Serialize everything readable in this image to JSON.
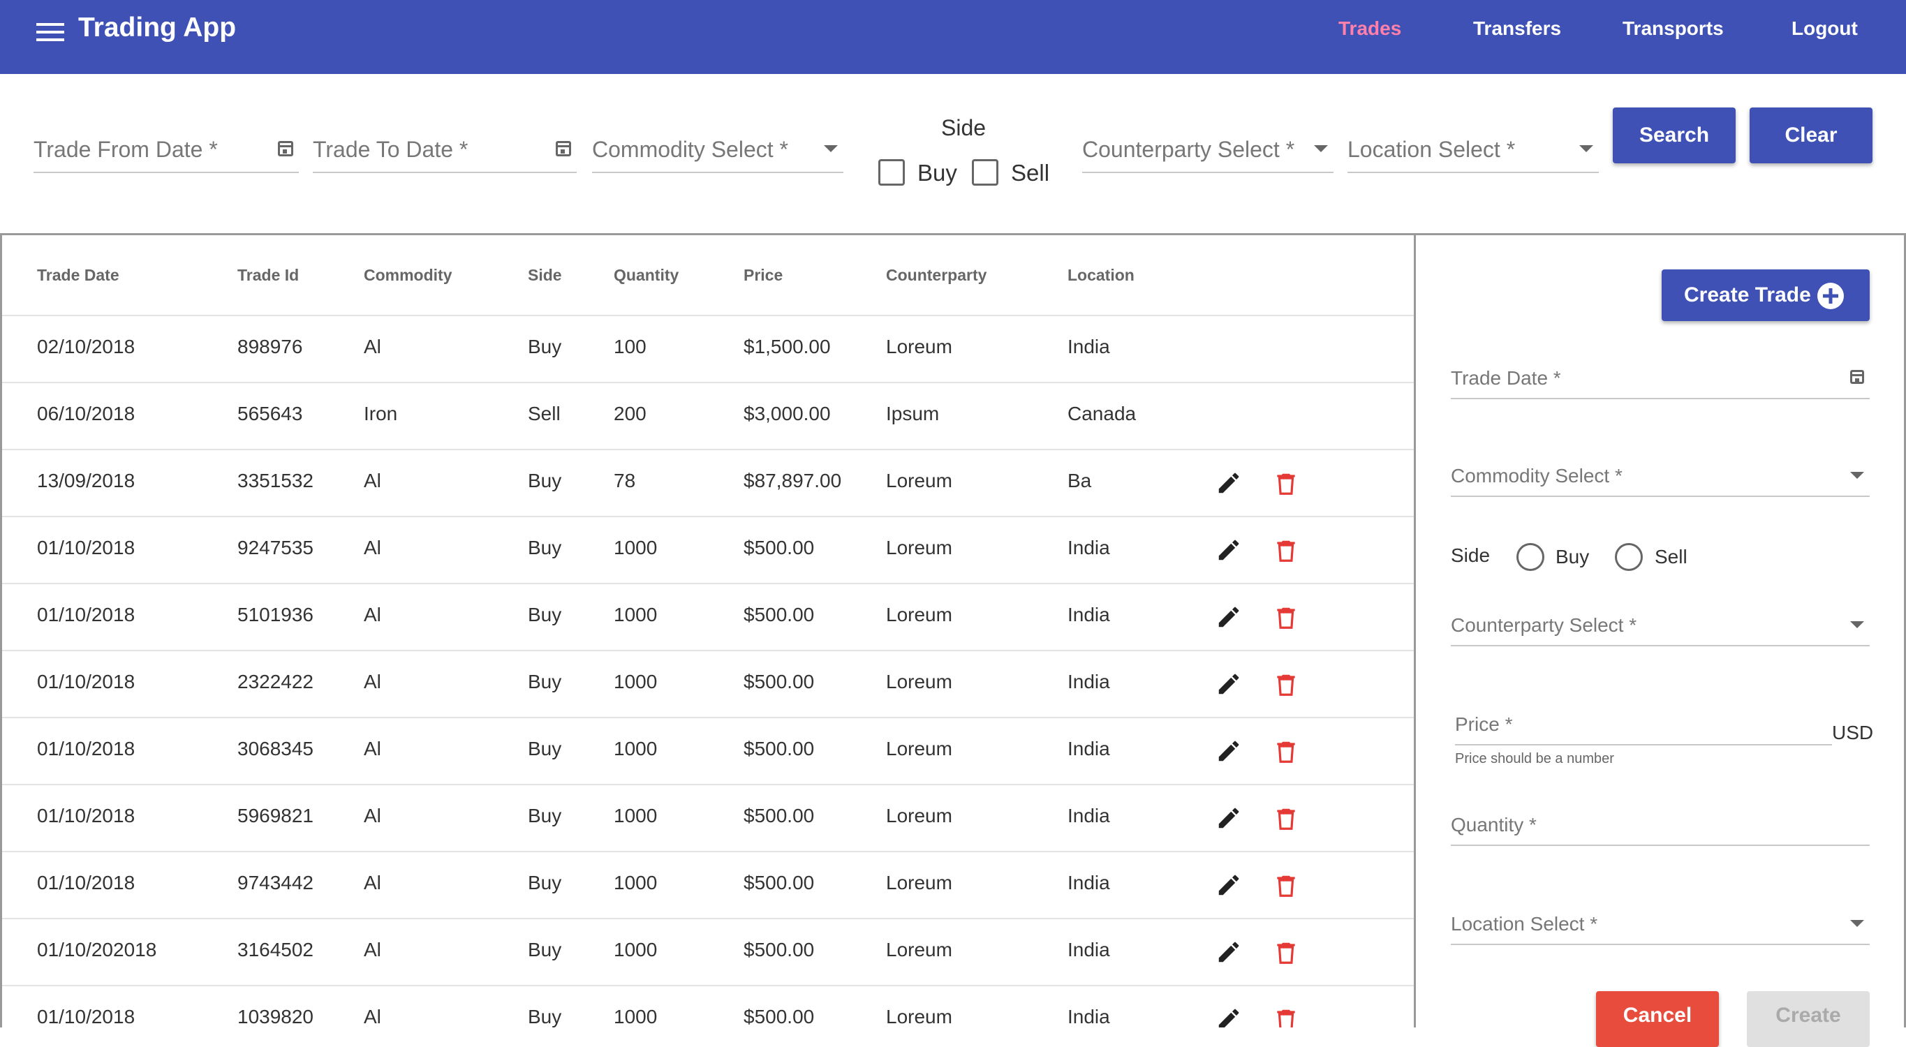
{
  "app": {
    "title": "Trading App"
  },
  "nav": [
    {
      "label": "Trades",
      "active": true
    },
    {
      "label": "Transfers"
    },
    {
      "label": "Transports"
    },
    {
      "label": "Logout"
    }
  ],
  "filters": {
    "trade_from_date": "Trade From Date *",
    "trade_to_date": "Trade To Date *",
    "commodity": "Commodity Select *",
    "side_label": "Side",
    "buy": "Buy",
    "sell": "Sell",
    "counterparty": "Counterparty Select *",
    "location": "Location Select *",
    "search_button": "Search",
    "clear_button": "Clear"
  },
  "table": {
    "columns": [
      "Trade Date",
      "Trade Id",
      "Commodity",
      "Side",
      "Quantity",
      "Price",
      "Counterparty",
      "Location"
    ],
    "rows": [
      {
        "trade_date": "02/10/2018",
        "trade_id": "898976",
        "commodity": "Al",
        "side": "Buy",
        "quantity": "100",
        "price": "$1,500.00",
        "counterparty": "Loreum",
        "location": "India",
        "actions": false
      },
      {
        "trade_date": "06/10/2018",
        "trade_id": "565643",
        "commodity": "Iron",
        "side": "Sell",
        "quantity": "200",
        "price": "$3,000.00",
        "counterparty": "Ipsum",
        "location": "Canada",
        "actions": false
      },
      {
        "trade_date": "13/09/2018",
        "trade_id": "3351532",
        "commodity": "Al",
        "side": "Buy",
        "quantity": "78",
        "price": "$87,897.00",
        "counterparty": "Loreum",
        "location": "Ba",
        "actions": true
      },
      {
        "trade_date": "01/10/2018",
        "trade_id": "9247535",
        "commodity": "Al",
        "side": "Buy",
        "quantity": "1000",
        "price": "$500.00",
        "counterparty": "Loreum",
        "location": "India",
        "actions": true
      },
      {
        "trade_date": "01/10/2018",
        "trade_id": "5101936",
        "commodity": "Al",
        "side": "Buy",
        "quantity": "1000",
        "price": "$500.00",
        "counterparty": "Loreum",
        "location": "India",
        "actions": true
      },
      {
        "trade_date": "01/10/2018",
        "trade_id": "2322422",
        "commodity": "Al",
        "side": "Buy",
        "quantity": "1000",
        "price": "$500.00",
        "counterparty": "Loreum",
        "location": "India",
        "actions": true
      },
      {
        "trade_date": "01/10/2018",
        "trade_id": "3068345",
        "commodity": "Al",
        "side": "Buy",
        "quantity": "1000",
        "price": "$500.00",
        "counterparty": "Loreum",
        "location": "India",
        "actions": true
      },
      {
        "trade_date": "01/10/2018",
        "trade_id": "5969821",
        "commodity": "Al",
        "side": "Buy",
        "quantity": "1000",
        "price": "$500.00",
        "counterparty": "Loreum",
        "location": "India",
        "actions": true
      },
      {
        "trade_date": "01/10/2018",
        "trade_id": "9743442",
        "commodity": "Al",
        "side": "Buy",
        "quantity": "1000",
        "price": "$500.00",
        "counterparty": "Loreum",
        "location": "India",
        "actions": true
      },
      {
        "trade_date": "01/10/202018",
        "trade_id": "3164502",
        "commodity": "Al",
        "side": "Buy",
        "quantity": "1000",
        "price": "$500.00",
        "counterparty": "Loreum",
        "location": "India",
        "actions": true
      },
      {
        "trade_date": "01/10/2018",
        "trade_id": "1039820",
        "commodity": "Al",
        "side": "Buy",
        "quantity": "1000",
        "price": "$500.00",
        "counterparty": "Loreum",
        "location": "India",
        "actions": true
      }
    ]
  },
  "form": {
    "create_trade_button": "Create Trade",
    "trade_date": "Trade Date *",
    "commodity": "Commodity Select *",
    "side_label": "Side",
    "buy": "Buy",
    "sell": "Sell",
    "counterparty": "Counterparty Select *",
    "price": "Price *",
    "currency": "USD",
    "price_hint": "Price should be a number",
    "quantity": "Quantity *",
    "location": "Location Select *",
    "cancel_button": "Cancel",
    "create_button": "Create"
  },
  "colors": {
    "primary": "#3f51b5",
    "nav_active": "#ff80ab",
    "delete": "#e53935",
    "cancel": "#e84c3d",
    "disabled": "#e0e0e0"
  },
  "icons": {
    "menu": "menu-icon",
    "calendar": "calendar-icon",
    "dropdown": "chevron-down-icon",
    "add": "add-circle-icon",
    "edit": "pencil-icon",
    "delete": "trash-icon"
  }
}
